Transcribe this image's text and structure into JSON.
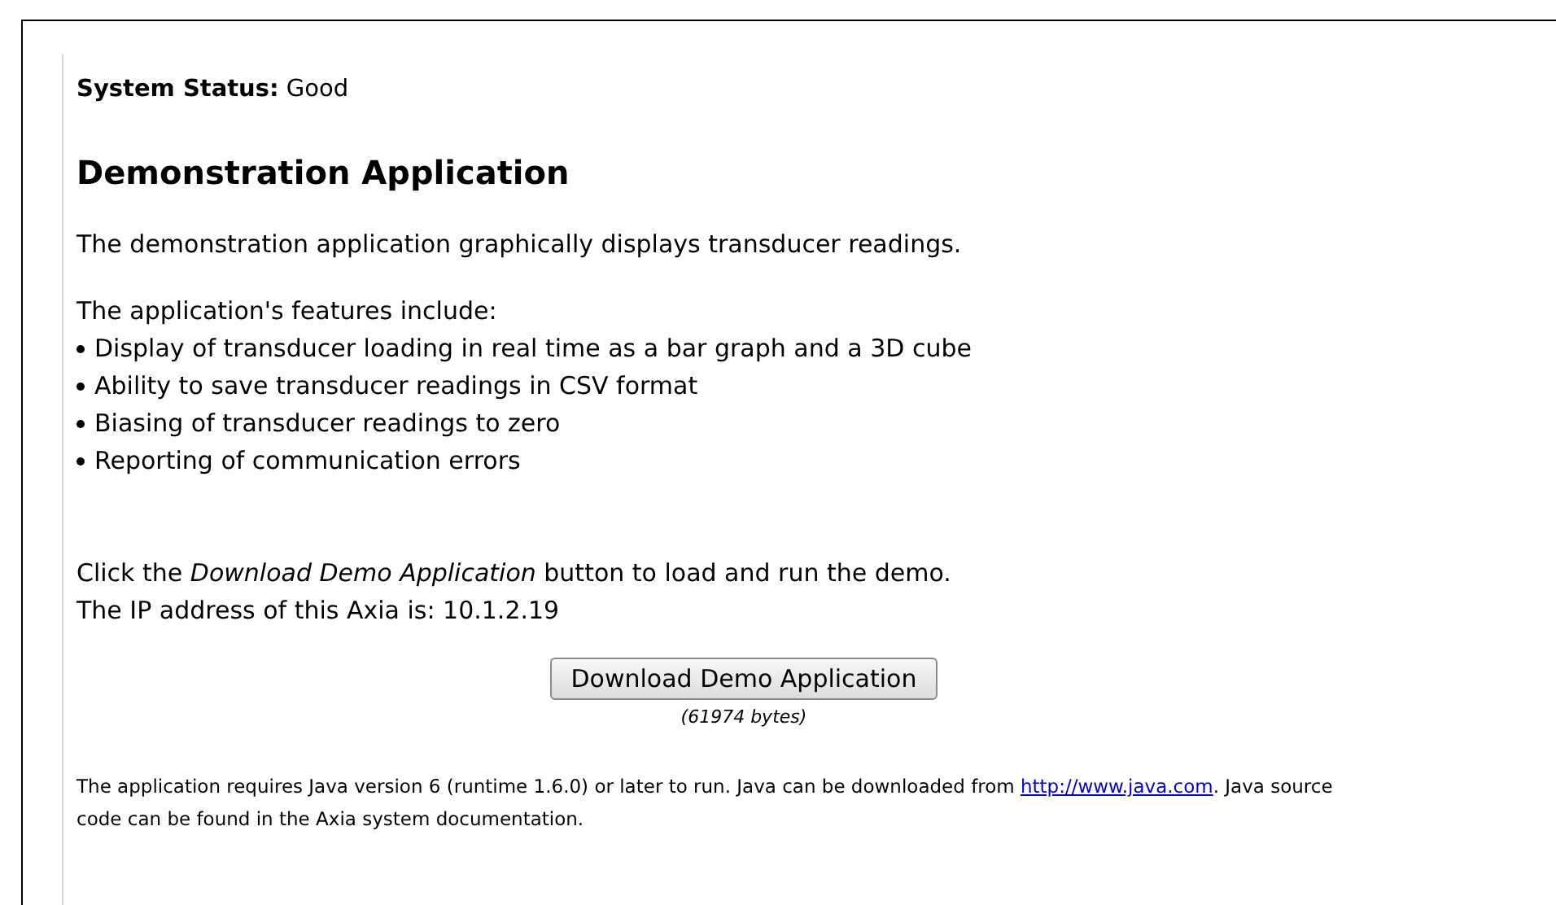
{
  "system_status": "**System Status:** Good",
  "heading": "Demonstration Application",
  "intro": "The demonstration application graphically displays transducer readings.",
  "features_intro": "The application's features include:",
  "features": [
    "Display of transducer loading in real time as a bar graph and a 3D cube",
    "Ability to save transducer readings in CSV format",
    "Biasing of transducer readings to zero",
    "Reporting of communication errors"
  ],
  "instruction": "Click the *Download Demo Application* button to load and run the demo.",
  "ip_line": "The IP address of this Axia is: 10.1.2.19",
  "download_button": "Download Demo Application",
  "file_size": "(61974 bytes)",
  "footer": {
    "before": "The application requires Java version 6 (runtime 1.6.0) or later to run. Java can be downloaded from ",
    "link": "http://www.java.com",
    "after": ". Java source code can be found in the Axia system documentation."
  }
}
